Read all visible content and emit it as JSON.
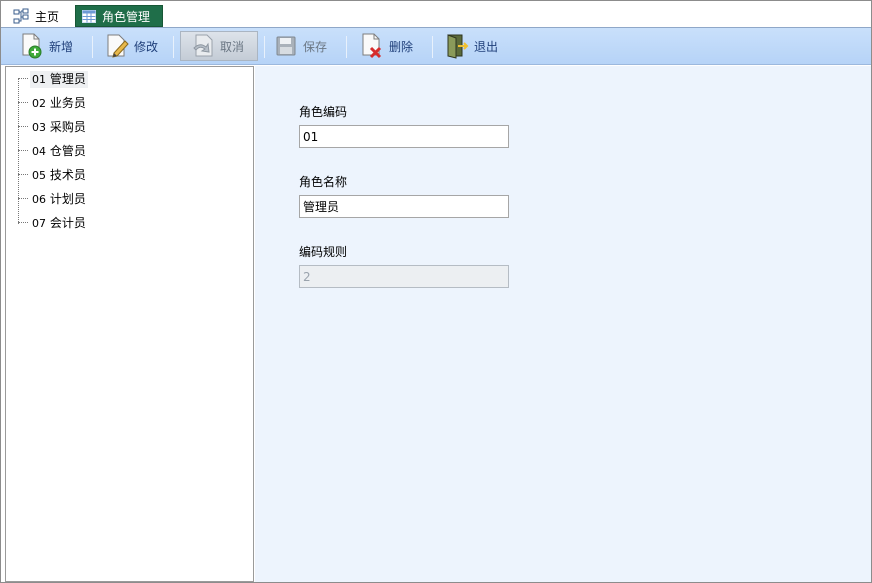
{
  "tabs": {
    "home_label": "主页",
    "role_label": "角色管理"
  },
  "toolbar": {
    "add_label": "新增",
    "edit_label": "修改",
    "cancel_label": "取消",
    "save_label": "保存",
    "delete_label": "删除",
    "exit_label": "退出"
  },
  "tree": {
    "items": [
      {
        "code": "01",
        "name": "管理员"
      },
      {
        "code": "02",
        "name": "业务员"
      },
      {
        "code": "03",
        "name": "采购员"
      },
      {
        "code": "04",
        "name": "仓管员"
      },
      {
        "code": "05",
        "name": "技术员"
      },
      {
        "code": "06",
        "name": "计划员"
      },
      {
        "code": "07",
        "name": "会计员"
      }
    ],
    "selected_index": 0
  },
  "form": {
    "role_code_label": "角色编码",
    "role_code_value": "01",
    "role_name_label": "角色名称",
    "role_name_value": "管理员",
    "code_rule_label": "编码规则",
    "code_rule_value": "2"
  },
  "colors": {
    "active_tab": "#1f6e49",
    "toolbar": "#c9e0fb",
    "form_bg": "#edf4fd"
  }
}
